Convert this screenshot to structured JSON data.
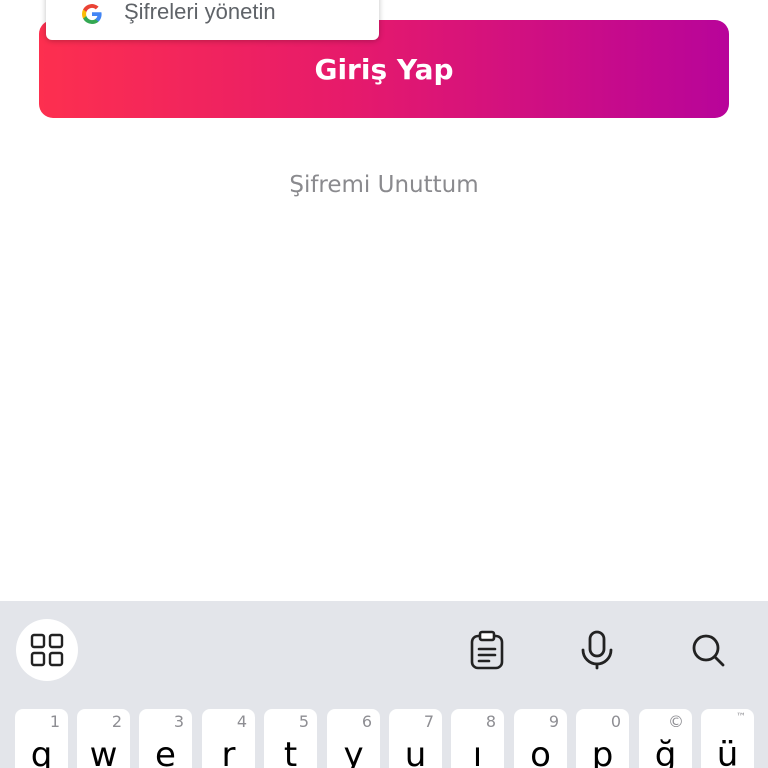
{
  "popup": {
    "text": "Şifreleri yönetin",
    "icon": "google-g-icon"
  },
  "login": {
    "button_label": "Giriş Yap",
    "gradient_colors": [
      "#fd2f4f",
      "#b8049a"
    ]
  },
  "forgot_password": {
    "label": "Şifremi Unuttum"
  },
  "keyboard": {
    "toolbar": {
      "icons": [
        "apps-grid-icon",
        "clipboard-icon",
        "microphone-icon",
        "search-icon"
      ]
    },
    "top_row": [
      {
        "letter": "q",
        "hint": "1"
      },
      {
        "letter": "w",
        "hint": "2"
      },
      {
        "letter": "e",
        "hint": "3"
      },
      {
        "letter": "r",
        "hint": "4"
      },
      {
        "letter": "t",
        "hint": "5"
      },
      {
        "letter": "y",
        "hint": "6"
      },
      {
        "letter": "u",
        "hint": "7"
      },
      {
        "letter": "ı",
        "hint": "8"
      },
      {
        "letter": "o",
        "hint": "9"
      },
      {
        "letter": "p",
        "hint": "0"
      },
      {
        "letter": "ğ",
        "hint": "©"
      },
      {
        "letter": "ü",
        "hint": "™"
      }
    ]
  }
}
